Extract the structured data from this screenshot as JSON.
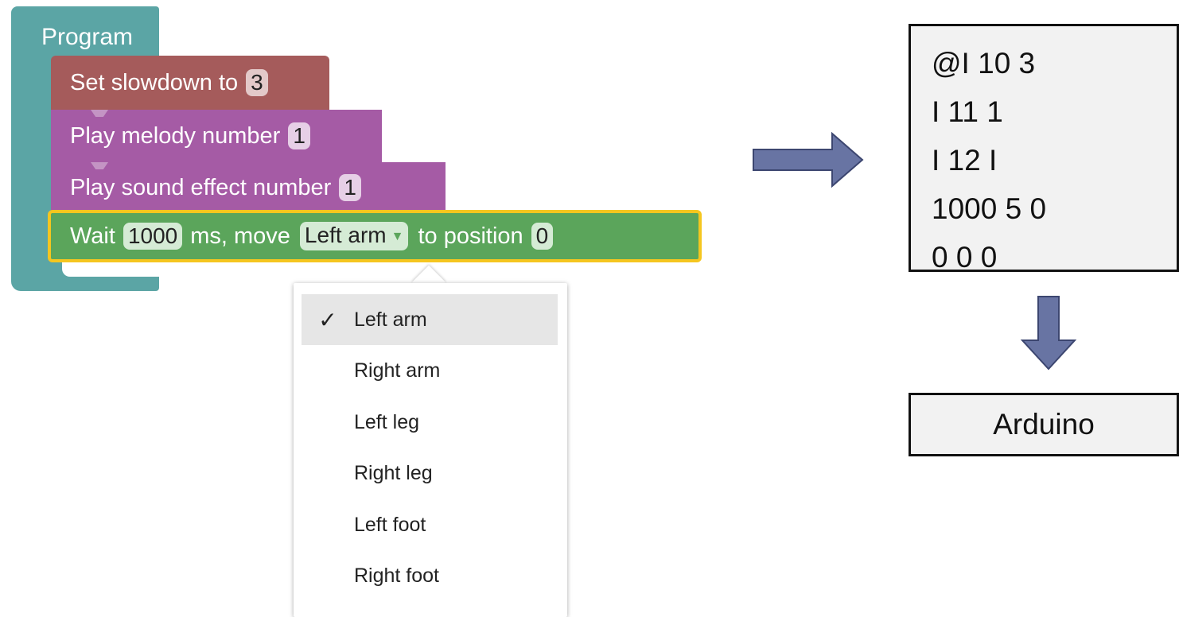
{
  "program": {
    "label": "Program",
    "blocks": [
      {
        "text": "Set slowdown to",
        "value": "3"
      },
      {
        "text": "Play melody number",
        "value": "1"
      },
      {
        "text": "Play sound effect number",
        "value": "1"
      }
    ],
    "wait_block": {
      "prefix": "Wait",
      "ms_value": "1000",
      "middle": "ms, move",
      "part_value": "Left arm",
      "suffix": "to position",
      "position_value": "0"
    }
  },
  "dropdown": {
    "options": [
      {
        "label": "Left arm",
        "selected": true,
        "check": "✓"
      },
      {
        "label": "Right arm",
        "selected": false
      },
      {
        "label": "Left leg",
        "selected": false
      },
      {
        "label": "Right leg",
        "selected": false
      },
      {
        "label": "Left foot",
        "selected": false
      },
      {
        "label": "Right foot",
        "selected": false
      }
    ]
  },
  "code_output": {
    "lines": [
      "@I 10 3",
      "I 11 1",
      "I 12 I",
      "1000 5 0",
      "0 0 0"
    ]
  },
  "target": {
    "label": "Arduino"
  },
  "colors": {
    "program": "#5ba5a5",
    "settings_block": "#a55b5b",
    "sound_block": "#a55ba5",
    "motion_block": "#5ba55b",
    "highlight": "#f5c61f",
    "arrow_fill": "#6874a3"
  }
}
